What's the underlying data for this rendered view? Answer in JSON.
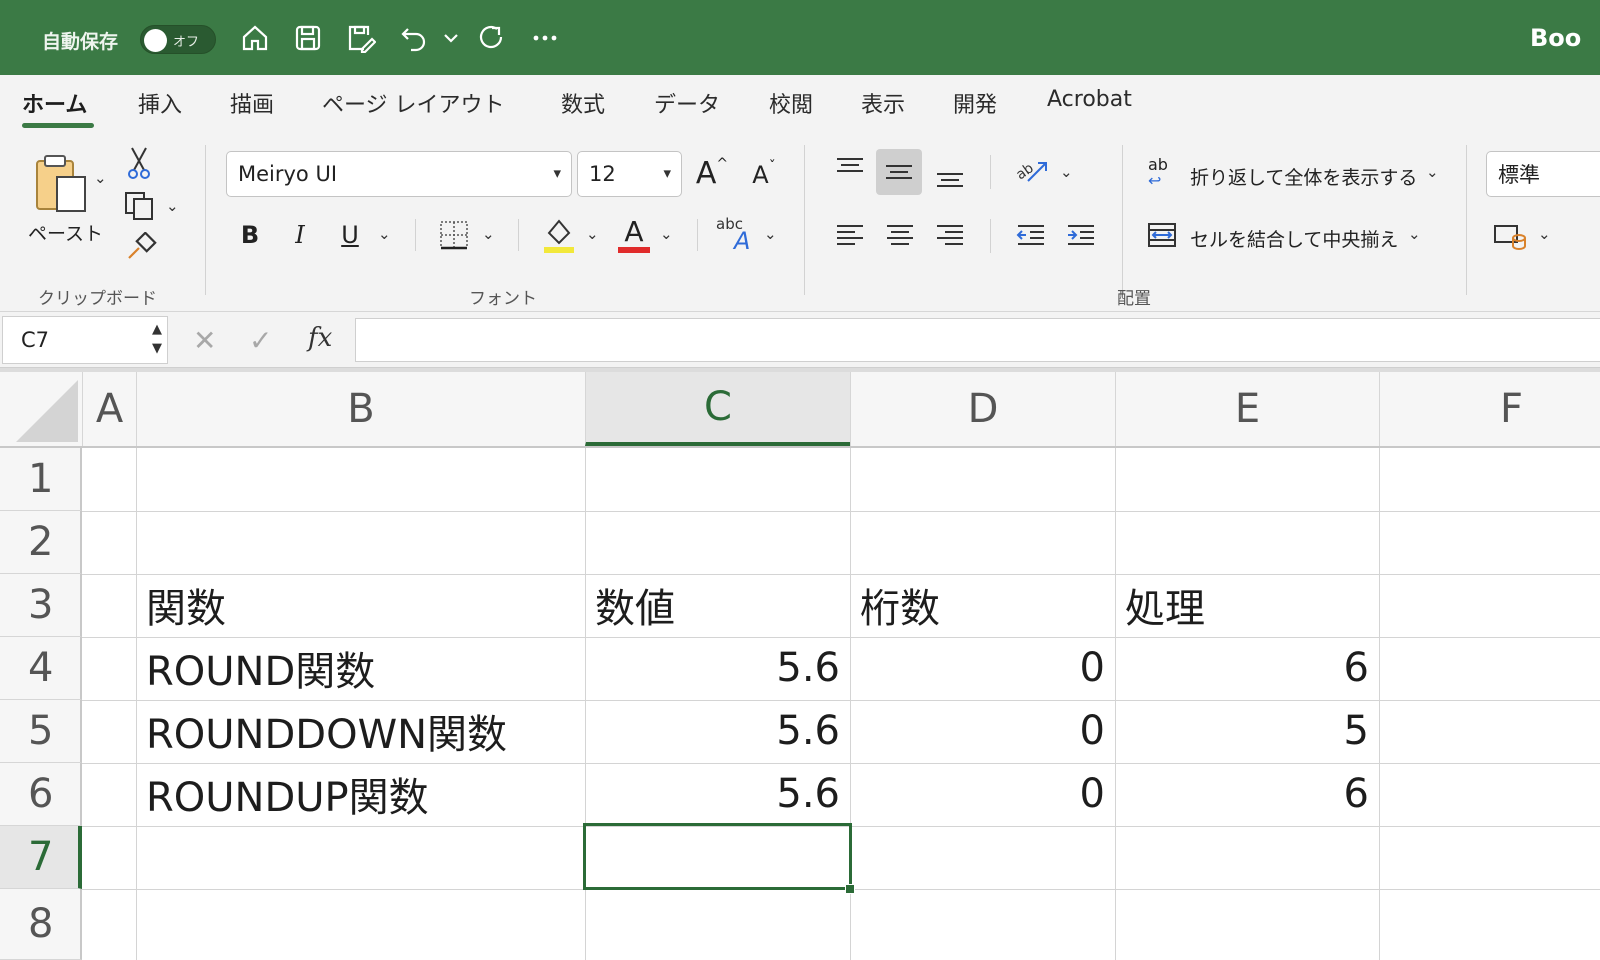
{
  "titlebar": {
    "autosave_label": "自動保存",
    "autosave_state": "オフ",
    "doc_title": "Boo",
    "icons": [
      "home-icon",
      "save-icon",
      "save-edit-icon",
      "undo-icon",
      "chevron-down-icon",
      "redo-icon",
      "more-icon"
    ]
  },
  "tabs": [
    {
      "label": "ホーム",
      "active": true
    },
    {
      "label": "挿入"
    },
    {
      "label": "描画"
    },
    {
      "label": "ページ レイアウト"
    },
    {
      "label": "数式"
    },
    {
      "label": "データ"
    },
    {
      "label": "校閲"
    },
    {
      "label": "表示"
    },
    {
      "label": "開発"
    },
    {
      "label": "Acrobat"
    }
  ],
  "ribbon": {
    "clipboard": {
      "paste_label": "ペースト",
      "group_label": "クリップボード"
    },
    "font": {
      "font_name": "Meiryo UI",
      "font_size": "12",
      "group_label": "フォント",
      "bold": "B",
      "italic": "I",
      "underline": "U",
      "font_color_glyph": "A",
      "grow_glyph": "A",
      "shrink_glyph": "A",
      "phonetic_small": "abc",
      "phonetic_big": "A"
    },
    "alignment": {
      "wrap_text": "折り返して全体を表示する",
      "merge_center": "セルを結合して中央揃え",
      "group_label": "配置",
      "wrap_icon_text": "ab"
    },
    "number": {
      "format": "標準"
    }
  },
  "formula_bar": {
    "name_box": "C7",
    "formula": "",
    "fx_label": "fx"
  },
  "grid": {
    "columns": [
      "A",
      "B",
      "C",
      "D",
      "E",
      "F"
    ],
    "selected_column": "C",
    "rows": [
      "1",
      "2",
      "3",
      "4",
      "5",
      "6",
      "7",
      "8"
    ],
    "selected_row": "7",
    "cells": {
      "B3": "関数",
      "C3": "数値",
      "D3": "桁数",
      "E3": "処理",
      "B4": "ROUND関数",
      "C4": "5.6",
      "D4": "0",
      "E4": "6",
      "B5": "ROUNDDOWN関数",
      "C5": "5.6",
      "D5": "0",
      "E5": "5",
      "B6": "ROUNDUP関数",
      "C6": "5.6",
      "D6": "0",
      "E6": "6"
    }
  }
}
